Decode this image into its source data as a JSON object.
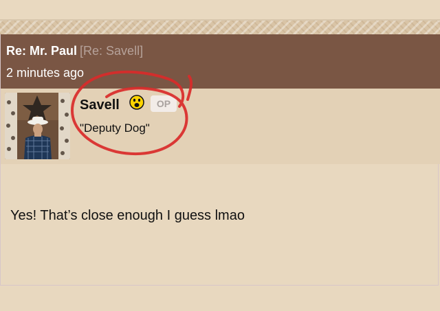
{
  "post": {
    "title": "Re: Mr. Paul",
    "reply_to": "[Re: Savell]",
    "timestamp": "2 minutes ago",
    "author": {
      "name": "Savell",
      "badge": "OP",
      "user_title": "\"Deputy Dog\"",
      "status_icon": "yellow-smiley-face-icon"
    },
    "body": "Yes! That’s close enough I guess lmao"
  },
  "colors": {
    "header_bg": "#7a5644",
    "author_row_bg": "#e3d1b6",
    "page_bg": "#e8d8bf",
    "annotation_red": "#d92a2a"
  }
}
